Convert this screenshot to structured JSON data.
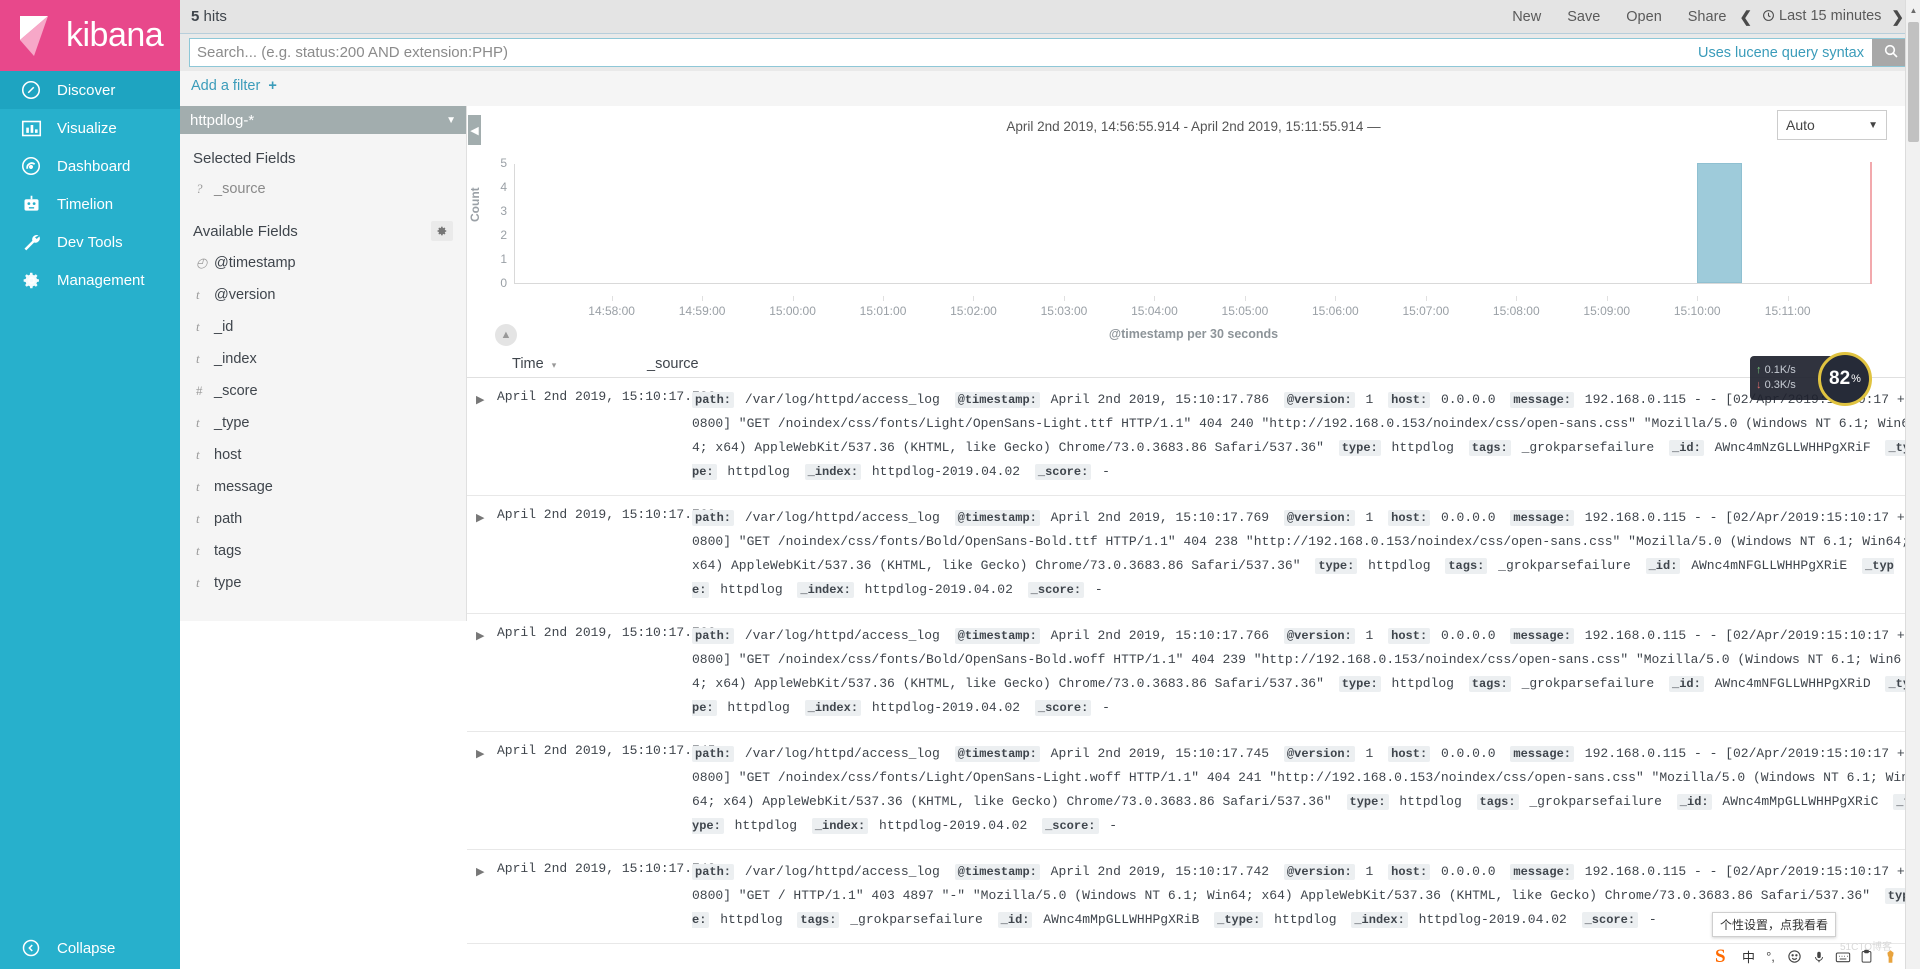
{
  "brand": {
    "name": "kibana"
  },
  "nav": {
    "items": [
      {
        "label": "Discover",
        "icon": "compass-icon",
        "active": true
      },
      {
        "label": "Visualize",
        "icon": "bar-chart-icon",
        "active": false
      },
      {
        "label": "Dashboard",
        "icon": "dashboard-icon",
        "active": false
      },
      {
        "label": "Timelion",
        "icon": "timelion-icon",
        "active": false
      },
      {
        "label": "Dev Tools",
        "icon": "wrench-icon",
        "active": false
      },
      {
        "label": "Management",
        "icon": "gear-icon",
        "active": false
      }
    ],
    "collapse_label": "Collapse"
  },
  "topbar": {
    "hits_count": "5",
    "hits_label": "hits",
    "actions": [
      "New",
      "Save",
      "Open",
      "Share"
    ],
    "time_range_label": "Last 15 minutes",
    "prev_arrow": "❮",
    "next_arrow": "❯"
  },
  "search": {
    "value": "",
    "placeholder": "Search... (e.g. status:200 AND extension:PHP)",
    "hint": "Uses lucene query syntax",
    "button_icon": "search-icon"
  },
  "filters": {
    "add_label": "Add a filter"
  },
  "sidebar": {
    "index_pattern": "httpdlog-*",
    "selected_fields_label": "Selected Fields",
    "selected_fields": [
      {
        "type": "?",
        "name": "_source"
      }
    ],
    "available_fields_label": "Available Fields",
    "available_fields": [
      {
        "type": "◴",
        "name": "@timestamp"
      },
      {
        "type": "t",
        "name": "@version"
      },
      {
        "type": "t",
        "name": "_id"
      },
      {
        "type": "t",
        "name": "_index"
      },
      {
        "type": "#",
        "name": "_score"
      },
      {
        "type": "t",
        "name": "_type"
      },
      {
        "type": "t",
        "name": "host"
      },
      {
        "type": "t",
        "name": "message"
      },
      {
        "type": "t",
        "name": "path"
      },
      {
        "type": "t",
        "name": "tags"
      },
      {
        "type": "t",
        "name": "type"
      }
    ]
  },
  "chart_header": {
    "time_range_text": "April 2nd 2019, 14:56:55.914 - April 2nd 2019, 15:11:55.914 —",
    "interval": "Auto"
  },
  "chart_data": {
    "type": "bar",
    "title": "",
    "xlabel": "@timestamp per 30 seconds",
    "ylabel": "Count",
    "ylim": [
      0,
      5
    ],
    "yticks": [
      0,
      1,
      2,
      3,
      4,
      5
    ],
    "grid": false,
    "legend": "none",
    "categories": [
      "14:58:00",
      "14:59:00",
      "15:00:00",
      "15:01:00",
      "15:02:00",
      "15:03:00",
      "15:04:00",
      "15:05:00",
      "15:06:00",
      "15:07:00",
      "15:08:00",
      "15:09:00",
      "15:10:00",
      "15:11:00"
    ],
    "bars": [
      {
        "x": "15:10:00",
        "value": 5,
        "bucket_width_seconds": 30
      }
    ],
    "values": [
      0,
      0,
      0,
      0,
      0,
      0,
      0,
      0,
      0,
      0,
      0,
      0,
      5,
      0
    ],
    "now_marker": "15:11:55.914"
  },
  "doc_table": {
    "columns": [
      "Time",
      "_source"
    ],
    "sort_indicator": "▾",
    "rows": [
      {
        "time": "April 2nd 2019, 15:10:17.786",
        "fields": [
          {
            "key": "path",
            "value": "/var/log/httpd/access_log"
          },
          {
            "key": "@timestamp",
            "value": "April 2nd 2019, 15:10:17.786"
          },
          {
            "key": "@version",
            "value": "1"
          },
          {
            "key": "host",
            "value": "0.0.0.0"
          },
          {
            "key": "message",
            "value": "192.168.0.115 - - [02/Apr/2019:15:10:17 +0800] \"GET /noindex/css/fonts/Light/OpenSans-Light.ttf HTTP/1.1\" 404 240 \"http://192.168.0.153/noindex/css/open-sans.css\" \"Mozilla/5.0 (Windows NT 6.1; Win64; x64) AppleWebKit/537.36 (KHTML, like Gecko) Chrome/73.0.3683.86 Safari/537.36\""
          },
          {
            "key": "type",
            "value": "httpdlog"
          },
          {
            "key": "tags",
            "value": "_grokparsefailure"
          },
          {
            "key": "_id",
            "value": "AWnc4mNzGLLWHHPgXRiF"
          },
          {
            "key": "_type",
            "value": "httpdlog"
          },
          {
            "key": "_index",
            "value": "httpdlog-2019.04.02"
          },
          {
            "key": "_score",
            "value": "-"
          }
        ]
      },
      {
        "time": "April 2nd 2019, 15:10:17.769",
        "fields": [
          {
            "key": "path",
            "value": "/var/log/httpd/access_log"
          },
          {
            "key": "@timestamp",
            "value": "April 2nd 2019, 15:10:17.769"
          },
          {
            "key": "@version",
            "value": "1"
          },
          {
            "key": "host",
            "value": "0.0.0.0"
          },
          {
            "key": "message",
            "value": "192.168.0.115 - - [02/Apr/2019:15:10:17 +0800] \"GET /noindex/css/fonts/Bold/OpenSans-Bold.ttf HTTP/1.1\" 404 238 \"http://192.168.0.153/noindex/css/open-sans.css\" \"Mozilla/5.0 (Windows NT 6.1; Win64; x64) AppleWebKit/537.36 (KHTML, like Gecko) Chrome/73.0.3683.86 Safari/537.36\""
          },
          {
            "key": "type",
            "value": "httpdlog"
          },
          {
            "key": "tags",
            "value": "_grokparsefailure"
          },
          {
            "key": "_id",
            "value": "AWnc4mNFGLLWHHPgXRiE"
          },
          {
            "key": "_type",
            "value": "httpdlog"
          },
          {
            "key": "_index",
            "value": "httpdlog-2019.04.02"
          },
          {
            "key": "_score",
            "value": "-"
          }
        ]
      },
      {
        "time": "April 2nd 2019, 15:10:17.766",
        "fields": [
          {
            "key": "path",
            "value": "/var/log/httpd/access_log"
          },
          {
            "key": "@timestamp",
            "value": "April 2nd 2019, 15:10:17.766"
          },
          {
            "key": "@version",
            "value": "1"
          },
          {
            "key": "host",
            "value": "0.0.0.0"
          },
          {
            "key": "message",
            "value": "192.168.0.115 - - [02/Apr/2019:15:10:17 +0800] \"GET /noindex/css/fonts/Bold/OpenSans-Bold.woff HTTP/1.1\" 404 239 \"http://192.168.0.153/noindex/css/open-sans.css\" \"Mozilla/5.0 (Windows NT 6.1; Win64; x64) AppleWebKit/537.36 (KHTML, like Gecko) Chrome/73.0.3683.86 Safari/537.36\""
          },
          {
            "key": "type",
            "value": "httpdlog"
          },
          {
            "key": "tags",
            "value": "_grokparsefailure"
          },
          {
            "key": "_id",
            "value": "AWnc4mNFGLLWHHPgXRiD"
          },
          {
            "key": "_type",
            "value": "httpdlog"
          },
          {
            "key": "_index",
            "value": "httpdlog-2019.04.02"
          },
          {
            "key": "_score",
            "value": "-"
          }
        ]
      },
      {
        "time": "April 2nd 2019, 15:10:17.745",
        "fields": [
          {
            "key": "path",
            "value": "/var/log/httpd/access_log"
          },
          {
            "key": "@timestamp",
            "value": "April 2nd 2019, 15:10:17.745"
          },
          {
            "key": "@version",
            "value": "1"
          },
          {
            "key": "host",
            "value": "0.0.0.0"
          },
          {
            "key": "message",
            "value": "192.168.0.115 - - [02/Apr/2019:15:10:17 +0800] \"GET /noindex/css/fonts/Light/OpenSans-Light.woff HTTP/1.1\" 404 241 \"http://192.168.0.153/noindex/css/open-sans.css\" \"Mozilla/5.0 (Windows NT 6.1; Win64; x64) AppleWebKit/537.36 (KHTML, like Gecko) Chrome/73.0.3683.86 Safari/537.36\""
          },
          {
            "key": "type",
            "value": "httpdlog"
          },
          {
            "key": "tags",
            "value": "_grokparsefailure"
          },
          {
            "key": "_id",
            "value": "AWnc4mMpGLLWHHPgXRiC"
          },
          {
            "key": "_type",
            "value": "httpdlog"
          },
          {
            "key": "_index",
            "value": "httpdlog-2019.04.02"
          },
          {
            "key": "_score",
            "value": "-"
          }
        ]
      },
      {
        "time": "April 2nd 2019, 15:10:17.742",
        "fields": [
          {
            "key": "path",
            "value": "/var/log/httpd/access_log"
          },
          {
            "key": "@timestamp",
            "value": "April 2nd 2019, 15:10:17.742"
          },
          {
            "key": "@version",
            "value": "1"
          },
          {
            "key": "host",
            "value": "0.0.0.0"
          },
          {
            "key": "message",
            "value": "192.168.0.115 - - [02/Apr/2019:15:10:17 +0800] \"GET / HTTP/1.1\" 403 4897 \"-\" \"Mozilla/5.0 (Windows NT 6.1; Win64; x64) AppleWebKit/537.36 (KHTML, like Gecko) Chrome/73.0.3683.86 Safari/537.36\""
          },
          {
            "key": "type",
            "value": "httpdlog"
          },
          {
            "key": "tags",
            "value": "_grokparsefailure"
          },
          {
            "key": "_id",
            "value": "AWnc4mMpGLLWHHPgXRiB"
          },
          {
            "key": "_type",
            "value": "httpdlog"
          },
          {
            "key": "_index",
            "value": "httpdlog-2019.04.02"
          },
          {
            "key": "_score",
            "value": "-"
          }
        ]
      }
    ]
  },
  "overlays": {
    "net_up": "0.1K/s",
    "net_down": "0.3K/s",
    "cpu_value": "82",
    "cpu_unit": "%",
    "ime_tooltip": "个性设置，点我看看",
    "ime_mode": "中",
    "watermark": "51CTO博客"
  },
  "colors": {
    "brand_pink": "#e8488b",
    "nav_teal": "#27b0cc",
    "nav_active": "#1ea4c1",
    "link_blue": "#3b9cba",
    "bar_blue": "#9ecbda",
    "now_marker": "#f2a9ad"
  }
}
